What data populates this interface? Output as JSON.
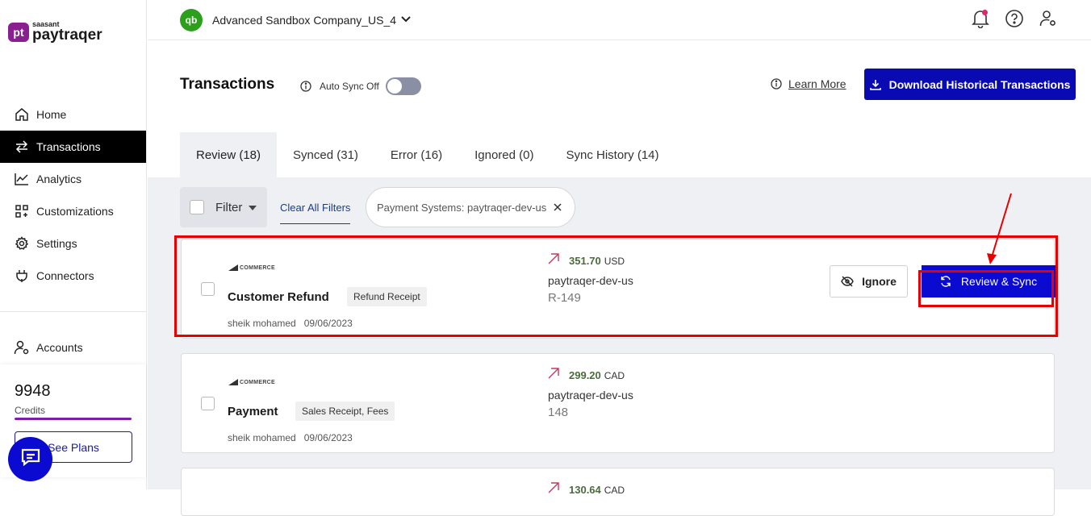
{
  "brand": {
    "small": "saasant",
    "name": "paytraqer",
    "mark": "pt"
  },
  "sidebar": {
    "items": [
      {
        "label": "Home",
        "icon": "home-icon"
      },
      {
        "label": "Transactions",
        "icon": "transfer-icon",
        "active": true
      },
      {
        "label": "Analytics",
        "icon": "analytics-icon"
      },
      {
        "label": "Customizations",
        "icon": "customizations-icon"
      },
      {
        "label": "Settings",
        "icon": "gear-icon"
      },
      {
        "label": "Connectors",
        "icon": "plug-icon"
      }
    ],
    "accounts_label": "Accounts",
    "credits_value": "9948",
    "credits_label": "Credits",
    "see_plans_label": "See Plans"
  },
  "topbar": {
    "qb_mark": "qb",
    "company": "Advanced Sandbox Company_US_4"
  },
  "header": {
    "title": "Transactions",
    "auto_sync_label": "Auto Sync Off",
    "auto_sync_on": false,
    "learn_more": "Learn More",
    "download_label": "Download Historical Transactions"
  },
  "tabs": [
    {
      "label": "Review (18)",
      "active": true
    },
    {
      "label": "Synced (31)"
    },
    {
      "label": "Error (16)"
    },
    {
      "label": "Ignored (0)"
    },
    {
      "label": "Sync History (14)"
    }
  ],
  "filters": {
    "filter_label": "Filter",
    "clear_all": "Clear All Filters",
    "chip": "Payment Systems: paytraqer-dev-us"
  },
  "transactions": [
    {
      "source": "COMMERCE",
      "title": "Customer Refund",
      "type": "Refund Receipt",
      "user": "sheik mohamed",
      "date": "09/06/2023",
      "amount": "351.70",
      "currency": "USD",
      "account": "paytraqer-dev-us",
      "ref": "R-149",
      "ignore_label": "Ignore",
      "sync_label": "Review & Sync"
    },
    {
      "source": "COMMERCE",
      "title": "Payment",
      "type": "Sales Receipt, Fees",
      "user": "sheik mohamed",
      "date": "09/06/2023",
      "amount": "299.20",
      "currency": "CAD",
      "account": "paytraqer-dev-us",
      "ref": "148"
    },
    {
      "amount": "130.64",
      "currency": "CAD"
    }
  ],
  "colors": {
    "primary": "#0a0ad0",
    "highlight": "#e80000",
    "amount": "#4a6b3a",
    "brand": "#8a1f8f"
  }
}
